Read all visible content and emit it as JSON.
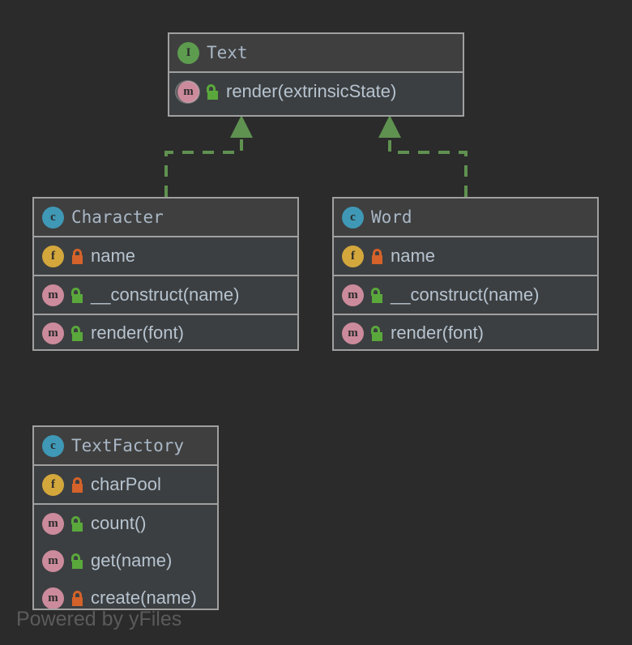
{
  "diagram": {
    "title": "UML Class Diagram",
    "background_color": "#2b2b2b",
    "watermark": "Powered by yFiles"
  },
  "palette": {
    "node_border": "#a0a0a0",
    "node_header_bg": "#3f3f3f",
    "node_body_bg": "#3c3f41",
    "interface_badge": "#5d9c4f",
    "class_badge": "#3f98b5",
    "field_badge": "#d3a73c",
    "method_badge": "#cc8b9c",
    "lock_public": "#5aa83c",
    "lock_private": "#d4622a",
    "edge_color": "#5f9150",
    "type_text": "#a9b7c6",
    "member_text": "#b6c3cf"
  },
  "nodes": {
    "text": {
      "name": "Text",
      "stereotype_icon": "interface-badge",
      "stereotype_letter": "I",
      "members": [
        {
          "kind_icon": "method-badge",
          "kind_letter": "m",
          "abstract": true,
          "visibility_icon": "open-lock-icon",
          "visibility": "public",
          "label": "render(extrinsicState)"
        }
      ]
    },
    "character": {
      "name": "Character",
      "stereotype_icon": "class-badge",
      "stereotype_letter": "c",
      "fields": [
        {
          "kind_icon": "field-badge",
          "kind_letter": "f",
          "visibility_icon": "closed-lock-icon",
          "visibility": "private",
          "label": "name"
        }
      ],
      "methods": [
        {
          "kind_icon": "method-badge",
          "kind_letter": "m",
          "visibility_icon": "open-lock-icon",
          "visibility": "public",
          "label": "__construct(name)"
        },
        {
          "kind_icon": "method-badge",
          "kind_letter": "m",
          "visibility_icon": "open-lock-icon",
          "visibility": "public",
          "label": "render(font)"
        }
      ]
    },
    "word": {
      "name": "Word",
      "stereotype_icon": "class-badge",
      "stereotype_letter": "c",
      "fields": [
        {
          "kind_icon": "field-badge",
          "kind_letter": "f",
          "visibility_icon": "closed-lock-icon",
          "visibility": "private",
          "label": "name"
        }
      ],
      "methods": [
        {
          "kind_icon": "method-badge",
          "kind_letter": "m",
          "visibility_icon": "open-lock-icon",
          "visibility": "public",
          "label": "__construct(name)"
        },
        {
          "kind_icon": "method-badge",
          "kind_letter": "m",
          "visibility_icon": "open-lock-icon",
          "visibility": "public",
          "label": "render(font)"
        }
      ]
    },
    "text_factory": {
      "name": "TextFactory",
      "stereotype_icon": "class-badge",
      "stereotype_letter": "c",
      "fields": [
        {
          "kind_icon": "field-badge",
          "kind_letter": "f",
          "visibility_icon": "closed-lock-icon",
          "visibility": "private",
          "label": "charPool"
        }
      ],
      "methods": [
        {
          "kind_icon": "method-badge",
          "kind_letter": "m",
          "visibility_icon": "open-lock-icon",
          "visibility": "public",
          "label": "count()"
        },
        {
          "kind_icon": "method-badge",
          "kind_letter": "m",
          "visibility_icon": "open-lock-icon",
          "visibility": "public",
          "label": "get(name)"
        },
        {
          "kind_icon": "method-badge",
          "kind_letter": "m",
          "visibility_icon": "closed-lock-icon",
          "visibility": "private",
          "label": "create(name)"
        }
      ]
    }
  },
  "edges": [
    {
      "from": "Character",
      "to": "Text",
      "type": "realization",
      "style": "dashed",
      "arrowhead": "triangle"
    },
    {
      "from": "Word",
      "to": "Text",
      "type": "realization",
      "style": "dashed",
      "arrowhead": "triangle"
    }
  ]
}
